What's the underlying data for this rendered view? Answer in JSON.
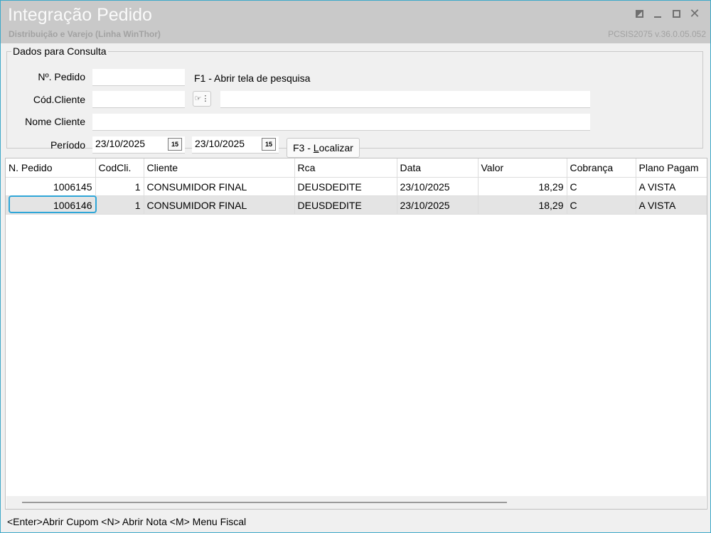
{
  "window": {
    "title": "Integração Pedido",
    "subtitle": "Distribuição e Varejo (Linha WinThor)",
    "version": "PCSIS2075  v.36.0.05.052",
    "close_glyph": "✕"
  },
  "search": {
    "legend": "Dados para Consulta",
    "pedido_label": "Nº. Pedido",
    "pedido_value": "",
    "f1_hint": "F1 - Abrir tela de pesquisa",
    "cliente_label": "Cód.Cliente",
    "cliente_value": "",
    "cliente_desc": "",
    "nome_label": "Nome Cliente",
    "nome_value": "",
    "periodo_label": "Período",
    "date_start": "23/10/2025",
    "date_end": "23/10/2025",
    "calendar_glyph": "15",
    "lookup_glyph": "☞⋮",
    "localizar_prefix": "F3 - ",
    "localizar_key": "L",
    "localizar_rest": "ocalizar"
  },
  "grid": {
    "columns": [
      "N. Pedido",
      "CodCli.",
      "Cliente",
      "Rca",
      "Data",
      "Valor",
      "Cobrança",
      "Plano Pagam"
    ],
    "rows": [
      [
        "1006145",
        "1",
        "CONSUMIDOR FINAL",
        "DEUSDEDITE",
        "23/10/2025",
        "18,29",
        "C",
        "A VISTA"
      ],
      [
        "1006146",
        "1",
        "CONSUMIDOR FINAL",
        "DEUSDEDITE",
        "23/10/2025",
        "18,29",
        "C",
        "A VISTA"
      ]
    ]
  },
  "status": {
    "text": "<Enter>Abrir Cupom   <N> Abrir Nota   <M> Menu Fiscal"
  },
  "colors": {
    "titlebar": "#c9c9c9",
    "accent": "#2fa6d8",
    "window_border": "#3fa9c9"
  }
}
